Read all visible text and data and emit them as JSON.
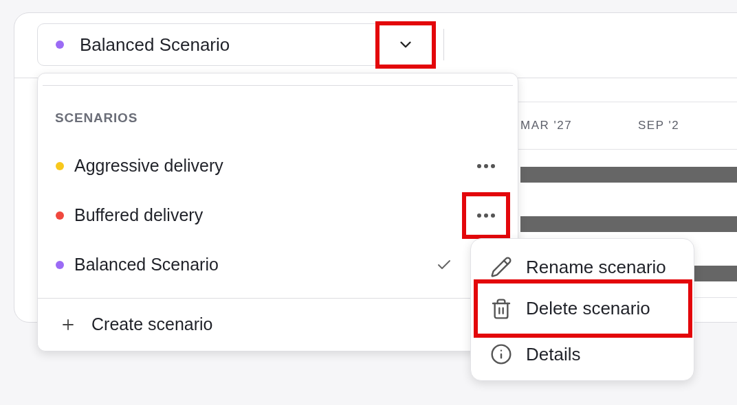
{
  "selector": {
    "label": "Balanced Scenario",
    "color": "#9b6bf5",
    "caret_highlighted": true
  },
  "timeline": {
    "columns": [
      "MAR '27",
      "SEP '2"
    ]
  },
  "dropdown": {
    "heading": "SCENARIOS",
    "scenarios": [
      {
        "name": "Aggressive delivery",
        "color": "#f8c81c",
        "selected": false,
        "more_highlighted": false
      },
      {
        "name": "Buffered delivery",
        "color": "#f0483e",
        "selected": false,
        "more_highlighted": true
      },
      {
        "name": "Balanced Scenario",
        "color": "#9b6bf5",
        "selected": true
      }
    ],
    "create_label": "Create scenario"
  },
  "context_menu": {
    "items": [
      {
        "kind": "rename",
        "label": "Rename scenario",
        "highlighted": false
      },
      {
        "kind": "delete",
        "label": "Delete scenario",
        "highlighted": true
      },
      {
        "kind": "details",
        "label": "Details",
        "highlighted": false
      }
    ]
  }
}
